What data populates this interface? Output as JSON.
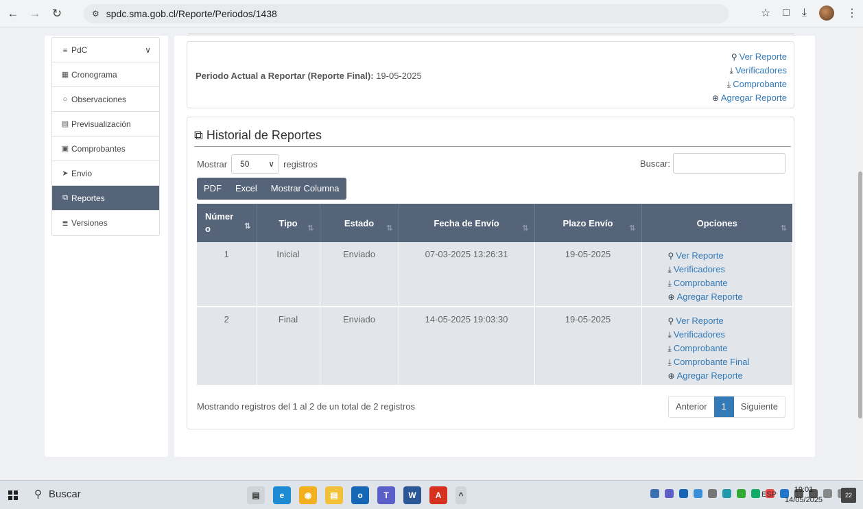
{
  "browser": {
    "url": "spdc.sma.gob.cl/Reporte/Periodos/1438"
  },
  "sidebar": {
    "items": [
      {
        "label": "PdC",
        "icon": "bars-icon"
      },
      {
        "label": "Cronograma",
        "icon": "calendar-icon"
      },
      {
        "label": "Observaciones",
        "icon": "comment-icon"
      },
      {
        "label": "Previsualización",
        "icon": "preview-icon"
      },
      {
        "label": "Comprobantes",
        "icon": "file-icon"
      },
      {
        "label": "Envio",
        "icon": "send-icon"
      },
      {
        "label": "Reportes",
        "icon": "copy-icon",
        "active": true
      },
      {
        "label": "Versiones",
        "icon": "list-icon"
      }
    ]
  },
  "period": {
    "label": "Periodo Actual a Reportar (Reporte Final):",
    "date": "19-05-2025",
    "actions": [
      "Ver Reporte",
      "Verificadores",
      "Comprobante",
      "Agregar Reporte"
    ]
  },
  "history": {
    "title": "Historial de Reportes",
    "show_label": "Mostrar",
    "show_value": "50",
    "records_label": "registros",
    "search_label": "Buscar:",
    "buttons": [
      "PDF",
      "Excel",
      "Mostrar Columna"
    ],
    "columns": {
      "num_line1": "Númer",
      "num_line2": "o",
      "tipo": "Tipo",
      "estado": "Estado",
      "fecha": "Fecha de Envío",
      "plazo": "Plazo Envío",
      "opciones": "Opciones"
    },
    "rows": [
      {
        "num": "1",
        "tipo": "Inicial",
        "estado": "Enviado",
        "fecha": "07-03-2025 13:26:31",
        "plazo": "19-05-2025",
        "options": [
          "Ver Reporte",
          "Verificadores",
          "Comprobante",
          "Agregar Reporte"
        ]
      },
      {
        "num": "2",
        "tipo": "Final",
        "estado": "Enviado",
        "fecha": "14-05-2025 19:03:30",
        "plazo": "19-05-2025",
        "options": [
          "Ver Reporte",
          "Verificadores",
          "Comprobante",
          "Comprobante Final",
          "Agregar Reporte"
        ]
      }
    ],
    "info": "Mostrando registros del 1 al 2 de un total de 2 registros",
    "pager": {
      "prev": "Anterior",
      "current": "1",
      "next": "Siguiente"
    }
  },
  "taskbar": {
    "search": "Buscar",
    "lang": "ESP",
    "time": "19:01",
    "date": "14/05/2025",
    "notifications": "22"
  },
  "colors": {
    "header_bg": "#556479",
    "link": "#337ab7",
    "row_bg": "#e2e5ea"
  }
}
